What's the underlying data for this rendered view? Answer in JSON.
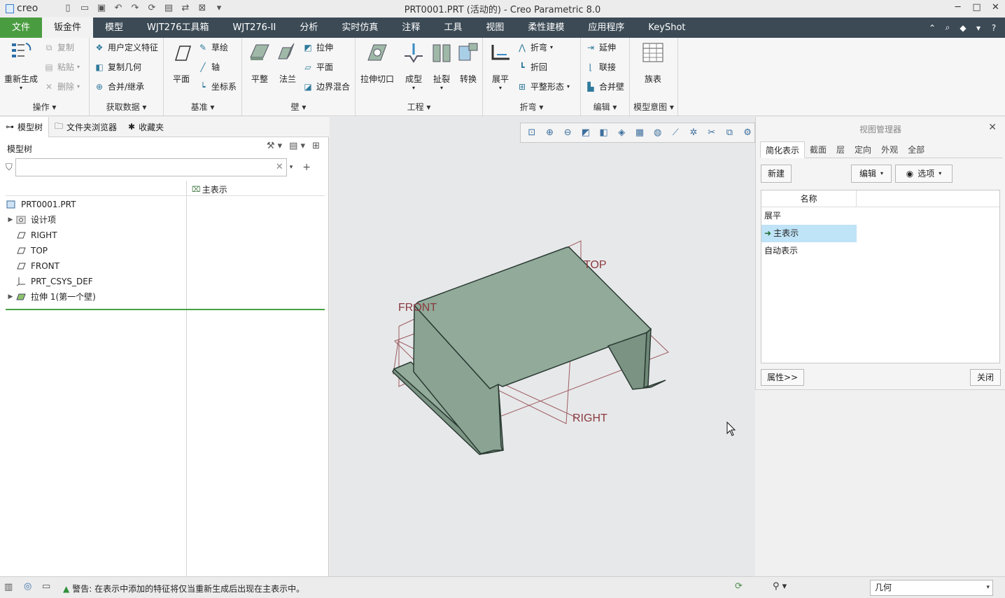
{
  "app": {
    "logo": "creo",
    "title": "PRT0001.PRT (活动的) - Creo Parametric 8.0"
  },
  "menu": {
    "items": [
      "文件",
      "钣金件",
      "模型",
      "WJT276工具箱",
      "WJT276-II",
      "分析",
      "实时仿真",
      "注释",
      "工具",
      "视图",
      "柔性建模",
      "应用程序",
      "KeyShot"
    ],
    "active": "钣金件"
  },
  "ribbon": {
    "ops": {
      "regen": "重新生成",
      "copy": "复制",
      "paste": "粘贴",
      "delete": "删除",
      "label": "操作"
    },
    "getdata": {
      "udf": "用户定义特征",
      "copygeom": "复制几何",
      "merge": "合并/继承",
      "label": "获取数据"
    },
    "datum": {
      "plane": "平面",
      "sketch": "草绘",
      "axis": "轴",
      "csys": "坐标系",
      "label": "基准"
    },
    "wall": {
      "flat": "平整",
      "flange": "法兰",
      "extrude": "拉伸",
      "planar": "平面",
      "blend": "边界混合",
      "label": "壁"
    },
    "eng": {
      "cut": "拉伸切口",
      "form": "成型",
      "rip": "扯裂",
      "convert": "转换",
      "label": "工程"
    },
    "bend": {
      "unbend": "展平",
      "bend": "折弯",
      "bendback": "折回",
      "flatstate": "平整形态",
      "label": "折弯"
    },
    "edit": {
      "extend": "延伸",
      "join": "联接",
      "mergewall": "合并壁",
      "label": "编辑"
    },
    "intent": {
      "family": "族表",
      "label": "模型意图"
    }
  },
  "nav": {
    "tabs": [
      "模型树",
      "文件夹浏览器",
      "收藏夹"
    ]
  },
  "tree": {
    "title": "模型树",
    "column2": "主表示",
    "filter_value": "",
    "items": [
      {
        "label": "PRT0001.PRT",
        "icon": "part-icon"
      },
      {
        "label": "设计项",
        "icon": "design-items-icon"
      },
      {
        "label": "RIGHT",
        "icon": "datum-plane-icon"
      },
      {
        "label": "TOP",
        "icon": "datum-plane-icon"
      },
      {
        "label": "FRONT",
        "icon": "datum-plane-icon"
      },
      {
        "label": "PRT_CSYS_DEF",
        "icon": "csys-icon"
      },
      {
        "label": "拉伸 1(第一个壁)",
        "icon": "extrude-wall-icon"
      }
    ]
  },
  "viewport": {
    "labels": {
      "top": "TOP",
      "front": "FRONT",
      "right": "RIGHT"
    }
  },
  "view_manager": {
    "title": "视图管理器",
    "tabs": [
      "简化表示",
      "截面",
      "层",
      "定向",
      "外观",
      "全部"
    ],
    "active_tab": "简化表示",
    "new": "新建",
    "edit": "编辑",
    "options": "选项",
    "col_name": "名称",
    "items": [
      "展平",
      "主表示",
      "自动表示"
    ],
    "selected": "主表示",
    "properties": "属性>>",
    "close": "关闭"
  },
  "status": {
    "message": "警告: 在表示中添加的特征将仅当重新生成后出现在主表示中。",
    "filter": "几何"
  },
  "colors": {
    "menubar": "#3b4a55",
    "file_tab": "#4a9c40",
    "sheet": "#8fa998",
    "datum": "#8a3a3f",
    "selection": "#bfe3f7"
  }
}
